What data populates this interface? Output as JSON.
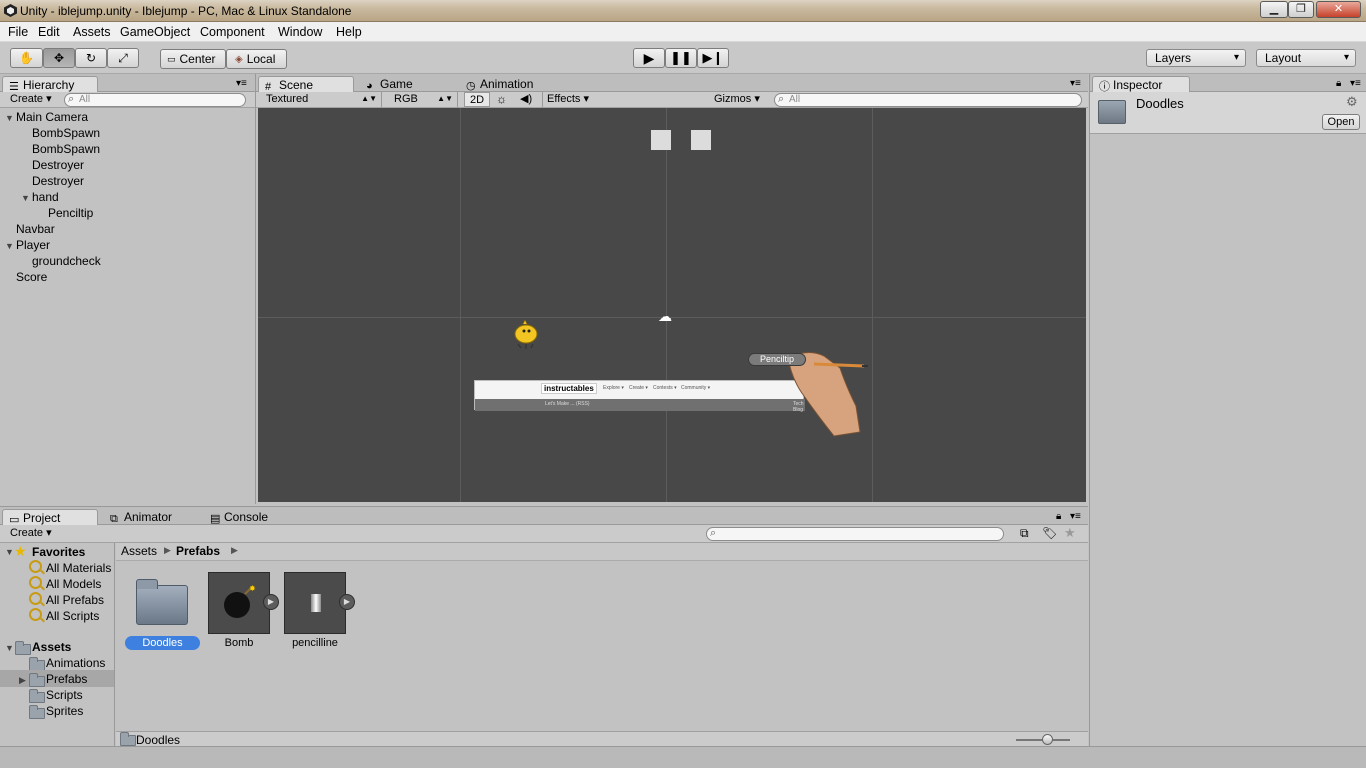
{
  "window": {
    "title": "Unity - iblejump.unity - Iblejump - PC, Mac & Linux Standalone",
    "min_label": "▁",
    "max_label": "❐",
    "close_label": "✕"
  },
  "menu": [
    "File",
    "Edit",
    "Assets",
    "GameObject",
    "Component",
    "Window",
    "Help"
  ],
  "toolbar": {
    "pivot_label": "Center",
    "space_label": "Local",
    "layers_label": "Layers",
    "layout_label": "Layout"
  },
  "hierarchy": {
    "tab": "Hierarchy",
    "create": "Create",
    "search_placeholder": "All",
    "items": [
      "Main Camera",
      "BombSpawn",
      "BombSpawn",
      "Destroyer",
      "Destroyer",
      "hand",
      "Penciltip",
      "Navbar",
      "Player",
      "groundcheck",
      "Score"
    ]
  },
  "center_tabs": [
    "Scene",
    "Game",
    "Animation"
  ],
  "scene_toolbar": {
    "render_mode": "Textured",
    "color_mode": "RGB",
    "mode_2d": "2D",
    "effects": "Effects",
    "gizmos": "Gizmos",
    "search_placeholder": "All"
  },
  "scene": {
    "penciltip_label": "Penciltip",
    "navbar_brand": "instructables",
    "navbar_menus": [
      "Explore ▾",
      "Create ▾",
      "Contests ▾",
      "Community ▾"
    ],
    "navbar_sub_left": "Let's Make ... (RSS)",
    "navbar_sub_right": "Tech Blog"
  },
  "inspector": {
    "tab": "Inspector",
    "object_name": "Doodles",
    "open_label": "Open"
  },
  "bottom_tabs": [
    "Project",
    "Animator",
    "Console"
  ],
  "project": {
    "create": "Create",
    "favorites_label": "Favorites",
    "favorites": [
      "All Materials",
      "All Models",
      "All Prefabs",
      "All Scripts"
    ],
    "assets_label": "Assets",
    "asset_folders": [
      "Animations",
      "Prefabs",
      "Scripts",
      "Sprites"
    ],
    "breadcrumb": [
      "Assets",
      "Prefabs"
    ],
    "items": [
      "Doodles",
      "Bomb",
      "pencilline"
    ],
    "footer_path": "Doodles"
  },
  "colors": {
    "selection_blue": "#3d80df",
    "panel_bg": "#c2c2c2",
    "scene_bg": "#484848"
  }
}
